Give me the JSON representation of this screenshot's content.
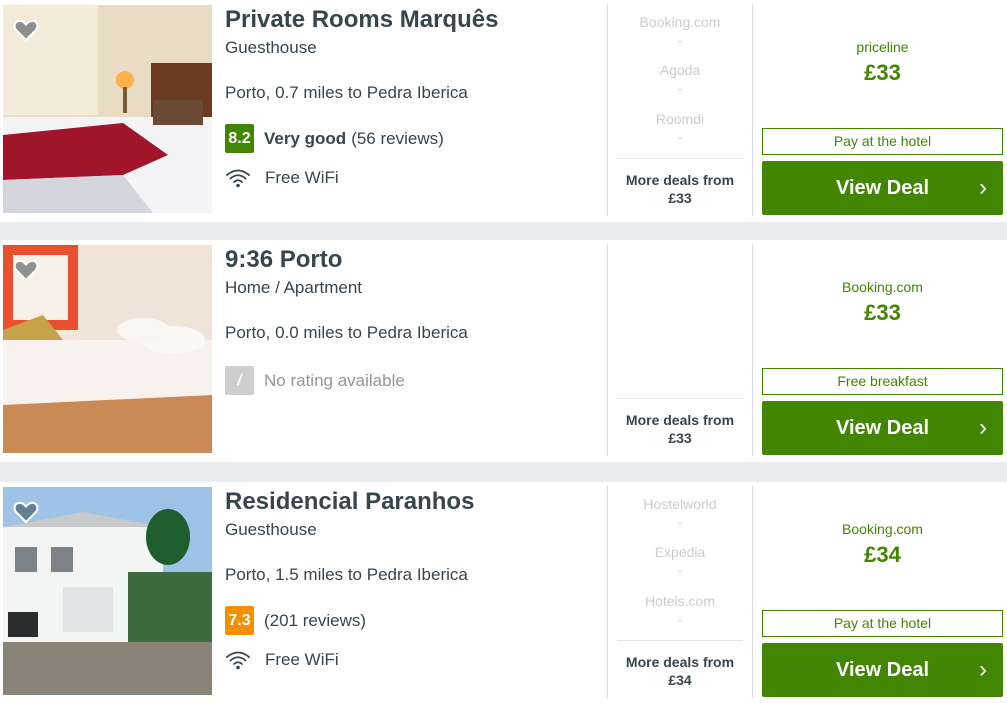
{
  "hotels": [
    {
      "name": "Private Rooms Marquês",
      "type": "Guesthouse",
      "location": "Porto, 0.7 miles to Pedra Iberica",
      "rating_score": "8.2",
      "rating_word": "Very good",
      "rating_count": "(56 reviews)",
      "amenity": "Free WiFi",
      "other_deals": [
        "Booking.com",
        "Agoda",
        "Roomdi"
      ],
      "more_deals_label": "More deals from",
      "more_deals_price": "£33",
      "provider": "priceline",
      "price": "£33",
      "tag": "Pay at the hotel",
      "cta": "View Deal"
    },
    {
      "name": "9:36 Porto",
      "type": "Home / Apartment",
      "location": "Porto, 0.0 miles to Pedra Iberica",
      "rating_score": "/",
      "rating_text": "No rating available",
      "more_deals_label": "More deals from",
      "more_deals_price": "£33",
      "provider": "Booking.com",
      "price": "£33",
      "tag": "Free breakfast",
      "cta": "View Deal"
    },
    {
      "name": "Residencial Paranhos",
      "type": "Guesthouse",
      "location": "Porto, 1.5 miles to Pedra Iberica",
      "rating_score": "7.3",
      "rating_count": "(201 reviews)",
      "amenity": "Free WiFi",
      "other_deals": [
        "Hostelworld",
        "Expedia",
        "Hotels.com"
      ],
      "more_deals_label": "More deals from",
      "more_deals_price": "£34",
      "provider": "Booking.com",
      "price": "£34",
      "tag": "Pay at the hotel",
      "cta": "View Deal"
    }
  ],
  "dash": "-",
  "colors": {
    "accent_green": "#428500",
    "rating_orange": "#f48f00",
    "text_dark": "#37454d",
    "muted": "#c9cccf"
  },
  "icons": {
    "favorite": "heart-icon",
    "wifi": "wifi-icon",
    "chevron": "chevron-right-icon"
  }
}
